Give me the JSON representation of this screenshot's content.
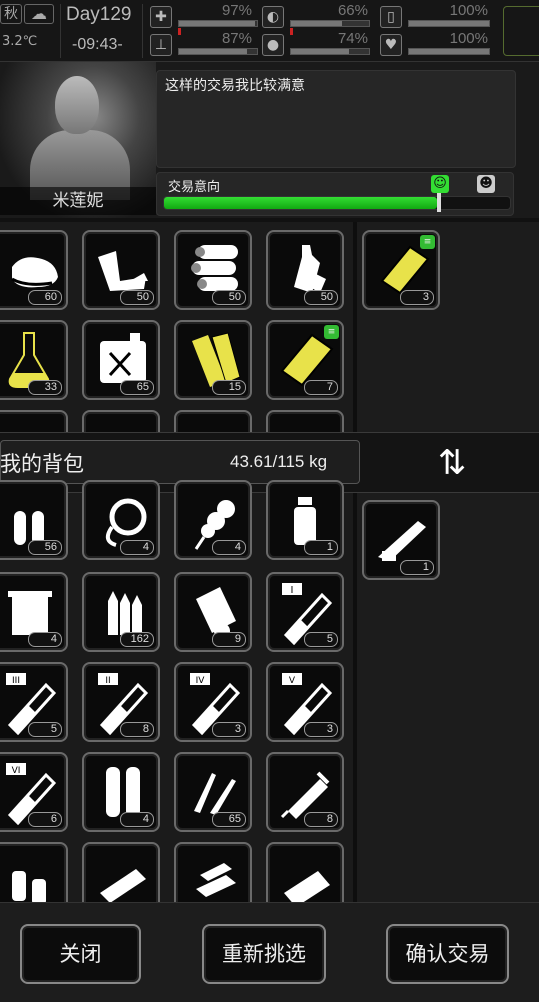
{
  "status": {
    "season": "秋",
    "weather_icon": "cloud-icon",
    "temperature": "3.2℃",
    "day": "Day129",
    "time": "-09:43-",
    "stats": [
      {
        "name": "health",
        "icon": "medkit-icon",
        "value": "97%",
        "level": 0.97
      },
      {
        "name": "hunger",
        "icon": "food-icon",
        "value": "66%",
        "level": 0.66
      },
      {
        "name": "energy",
        "icon": "battery-icon",
        "value": "100%",
        "level": 1.0
      },
      {
        "name": "stamina",
        "icon": "leg-icon",
        "value": "87%",
        "level": 0.87
      },
      {
        "name": "thirst",
        "icon": "water-drop-icon",
        "value": "74%",
        "level": 0.74
      },
      {
        "name": "mood",
        "icon": "heart-icon",
        "value": "100%",
        "level": 1.0
      }
    ]
  },
  "trader": {
    "name": "米莲妮",
    "dialog": "这样的交易我比较满意",
    "intent_label": "交易意向",
    "intent_level": 0.79
  },
  "backpack": {
    "title": "我的背包",
    "weight": "43.61/115 kg"
  },
  "counts": {
    "cloth": "60",
    "bandage": "50",
    "logs": "50",
    "bottles": "50",
    "trader_offer": "3",
    "flask": "33",
    "fuel": "65",
    "planks": "15",
    "board": "7",
    "bullets": "56",
    "rope": "4",
    "kebab": "4",
    "water": "1",
    "trade_gun": "1",
    "towel": "4",
    "rifle_ammo": "162",
    "scroll": "9",
    "serum1": "5",
    "serum3": "5",
    "serum2": "8",
    "serum4": "3",
    "serum5": "3",
    "serum6": "6",
    "shells": "4",
    "cartridges": "65",
    "syringe": "8"
  },
  "buttons": {
    "close": "关闭",
    "reselect": "重新挑选",
    "confirm": "确认交易"
  },
  "colors": {
    "accent_green": "#33cc33",
    "item_yellow": "#e8e24a"
  }
}
